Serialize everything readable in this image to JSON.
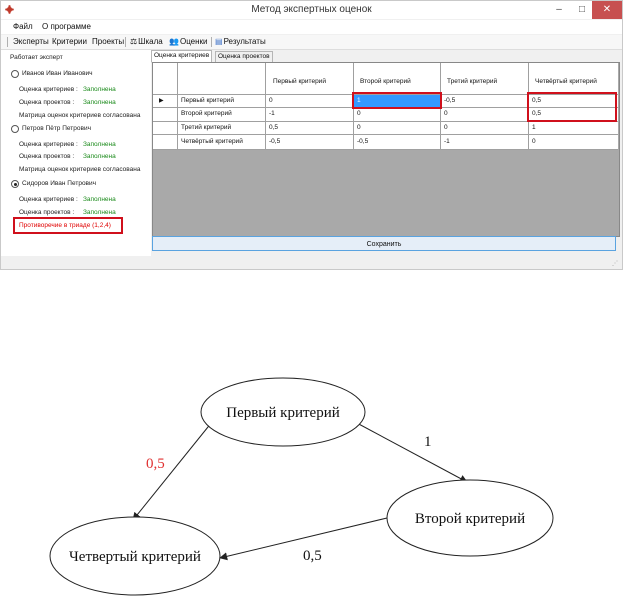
{
  "window": {
    "title": "Метод экспертных оценок"
  },
  "menu": [
    "Файл",
    "О программе"
  ],
  "toolbar": {
    "experts": "Эксперты",
    "criteria": "Критерии",
    "projects": "Проекты",
    "scale": "Шкала",
    "ratings": "Оценки",
    "results": "Результаты"
  },
  "left_panel": {
    "heading": "Работает эксперт",
    "experts": [
      {
        "name": "Иванов Иван Иванович",
        "selected": false,
        "lines": [
          {
            "label": "Оценка критериев :",
            "status": "Заполнена"
          },
          {
            "label": "Оценка проектов :",
            "status": "Заполнена"
          },
          {
            "label": "Матрица оценок критериев согласована",
            "status": ""
          }
        ]
      },
      {
        "name": "Петров Пётр Петрович",
        "selected": false,
        "lines": [
          {
            "label": "Оценка критериев :",
            "status": "Заполнена"
          },
          {
            "label": "Оценка проектов :",
            "status": "Заполнена"
          },
          {
            "label": "Матрица оценок критериев согласована",
            "status": ""
          }
        ]
      },
      {
        "name": "Сидоров Иван Петрович",
        "selected": true,
        "lines": [
          {
            "label": "Оценка критериев :",
            "status": "Заполнена"
          },
          {
            "label": "Оценка проектов :",
            "status": "Заполнена"
          }
        ]
      }
    ],
    "contradiction": "Противоречие в триаде (1,2,4)"
  },
  "tabs": [
    "Оценка критериев",
    "Оценка проектов"
  ],
  "grid": {
    "columns": [
      "Первый критерий",
      "Второй критерий",
      "Третий критерий",
      "Четвёртый критерий"
    ],
    "rows": [
      {
        "name": "Первый критерий",
        "values": [
          "0",
          "1",
          "-0,5",
          "0,5"
        ]
      },
      {
        "name": "Второй критерий",
        "values": [
          "-1",
          "0",
          "0",
          "0,5"
        ]
      },
      {
        "name": "Третий критерий",
        "values": [
          "0,5",
          "0",
          "0",
          "1"
        ]
      },
      {
        "name": "Четвёртый критерий",
        "values": [
          "-0,5",
          "-0,5",
          "-1",
          "0"
        ]
      }
    ]
  },
  "save_label": "Сохранить",
  "diagram": {
    "nodes": {
      "first": "Первый критерий",
      "second": "Второй критерий",
      "fourth": "Четвертый критерий"
    },
    "edges": {
      "first_second": "1",
      "first_fourth": "0,5",
      "second_fourth": "0,5"
    },
    "colors": {
      "red_edge_label": "#e03030",
      "default_edge_label": "#111111"
    }
  },
  "colors": {
    "selection": "#3399ff",
    "highlight_box": "#d0101c",
    "status_ok": "#1a8a1a",
    "close_button": "#c75050"
  }
}
